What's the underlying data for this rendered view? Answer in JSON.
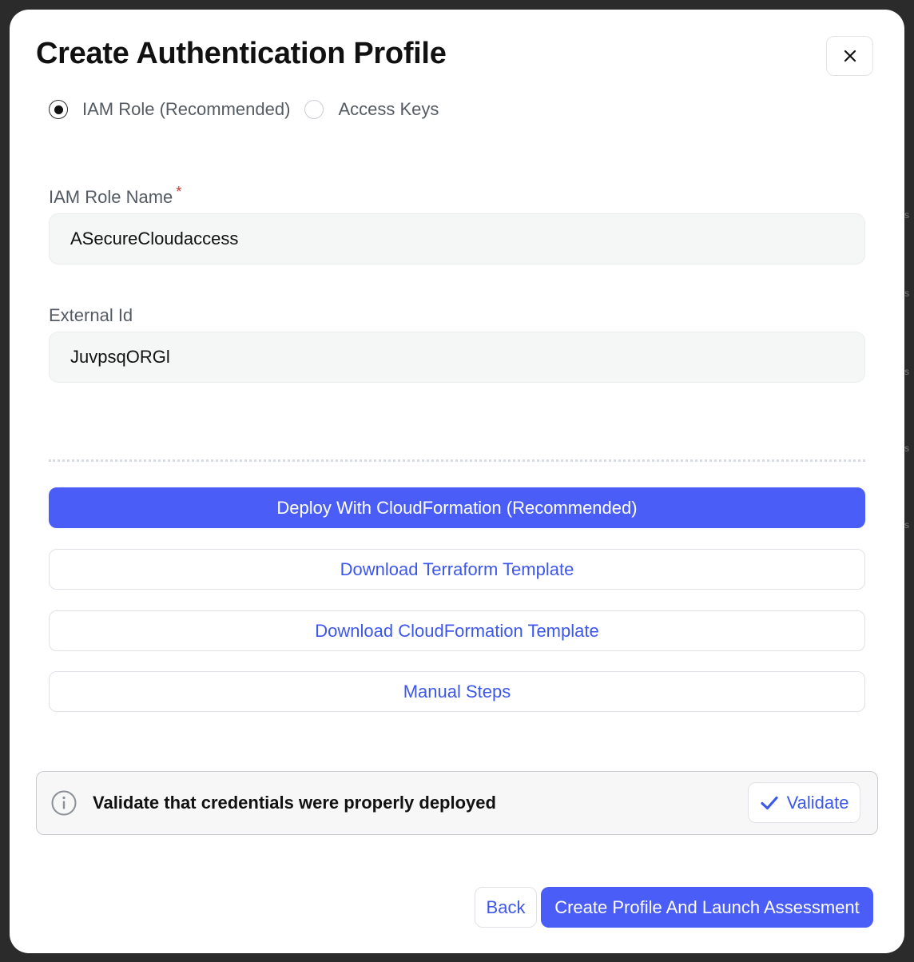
{
  "modal": {
    "title": "Create Authentication Profile",
    "close_icon": "close-icon"
  },
  "auth_method": {
    "options": [
      {
        "label": "IAM Role (Recommended)",
        "selected": true
      },
      {
        "label": "Access Keys",
        "selected": false
      }
    ]
  },
  "form": {
    "iam_role_name": {
      "label": "IAM Role Name",
      "required_mark": "*",
      "value": "ASecureCloudaccess"
    },
    "external_id": {
      "label": "External Id",
      "value": "JuvpsqORGl"
    }
  },
  "actions": {
    "deploy_cloudformation": "Deploy With CloudFormation (Recommended)",
    "download_terraform": "Download Terraform Template",
    "download_cloudformation": "Download CloudFormation Template",
    "manual_steps": "Manual Steps"
  },
  "validation": {
    "info_icon": "info-icon",
    "message": "Validate that credentials were properly deployed",
    "button_icon": "checkmark-icon",
    "button_label": "Validate"
  },
  "footer": {
    "back_label": "Back",
    "create_label": "Create Profile And Launch Assessment"
  },
  "colors": {
    "accent": "#4a5ef7",
    "link": "#3d57ec",
    "required": "#d0342c",
    "backdrop": "#2b2b2b"
  }
}
